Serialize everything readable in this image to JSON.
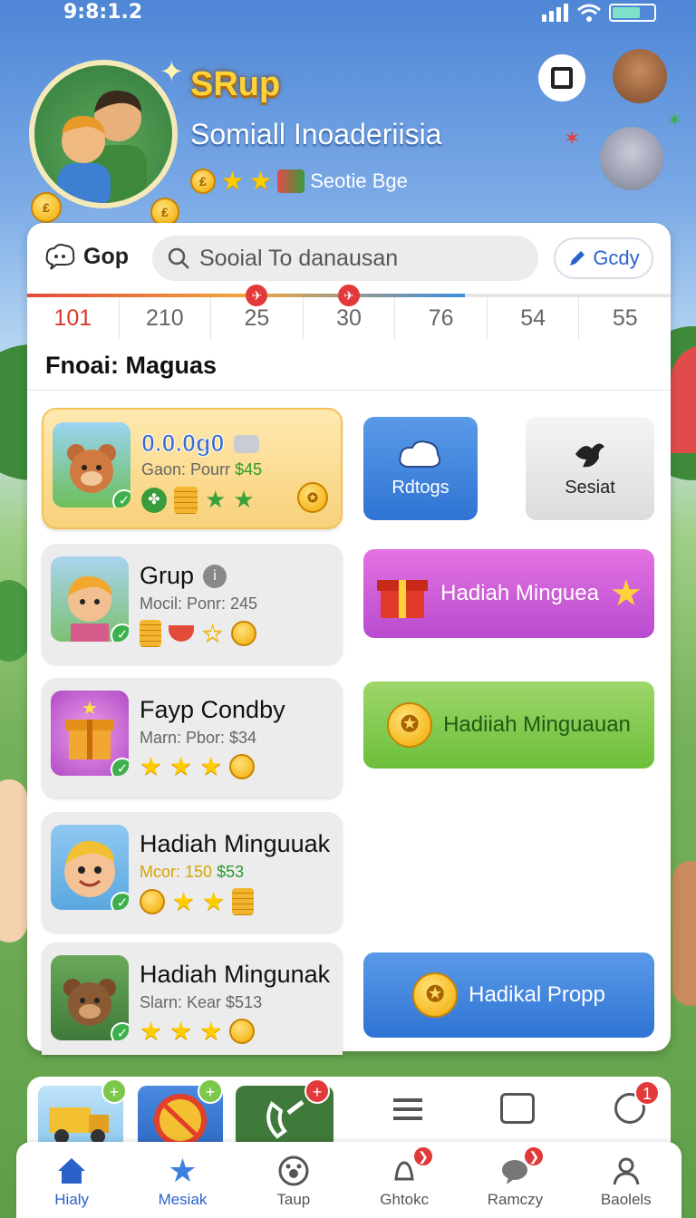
{
  "status": {
    "time": "9:8:1.2"
  },
  "header": {
    "brand": "SRup",
    "subtitle": "Somiall Inoaderiisia",
    "badge_label": "Seotie Bge",
    "coin_glyph": "₤"
  },
  "topbar": {
    "label": "Gop",
    "search_placeholder": "Sooial To danausan",
    "action_label": "Gcdy"
  },
  "progress": {
    "fraction": 0.68,
    "values": [
      "101",
      "210",
      "25",
      "30",
      "76",
      "54",
      "55"
    ]
  },
  "section": {
    "title": "Fnoai: Maguas"
  },
  "cards": [
    {
      "title": "0.0.0g0",
      "subtitle": "Gaon: Pourr",
      "price": "$45"
    },
    {
      "title": "Grup",
      "subtitle": "Mocil: Ponr: 245",
      "price": ""
    },
    {
      "title": "Fayp Condby",
      "subtitle": "Marn: Pbor: $34",
      "price": ""
    },
    {
      "title": "Hadiah Minguuak",
      "subtitle": "Mcor: 150",
      "price": "$53"
    },
    {
      "title": "Hadiah Mingunak",
      "subtitle": "Slarn: Kear $513",
      "price": ""
    }
  ],
  "right_buttons": {
    "rdtogs": "Rdtogs",
    "sesiat": "Sesiat",
    "pink": "Hadiah Minguea",
    "green": "Hadiiah Minguauan",
    "blue": "Hadikal Propp"
  },
  "tray_badges": [
    "+",
    "+",
    "+",
    "1"
  ],
  "tabs": [
    {
      "label": "Hialy",
      "icon": "home-icon"
    },
    {
      "label": "Mesiak",
      "icon": "star-icon"
    },
    {
      "label": "Taup",
      "icon": "paw-icon"
    },
    {
      "label": "Ghtokc",
      "icon": "bell-icon"
    },
    {
      "label": "Ramczy",
      "icon": "chat-icon"
    },
    {
      "label": "Baolels",
      "icon": "user-icon"
    }
  ],
  "colors": {
    "accent": "#2a62c9",
    "gold": "#ffd23a",
    "pink": "#d457d8",
    "green": "#7cc84a",
    "blue": "#3a80dc"
  }
}
